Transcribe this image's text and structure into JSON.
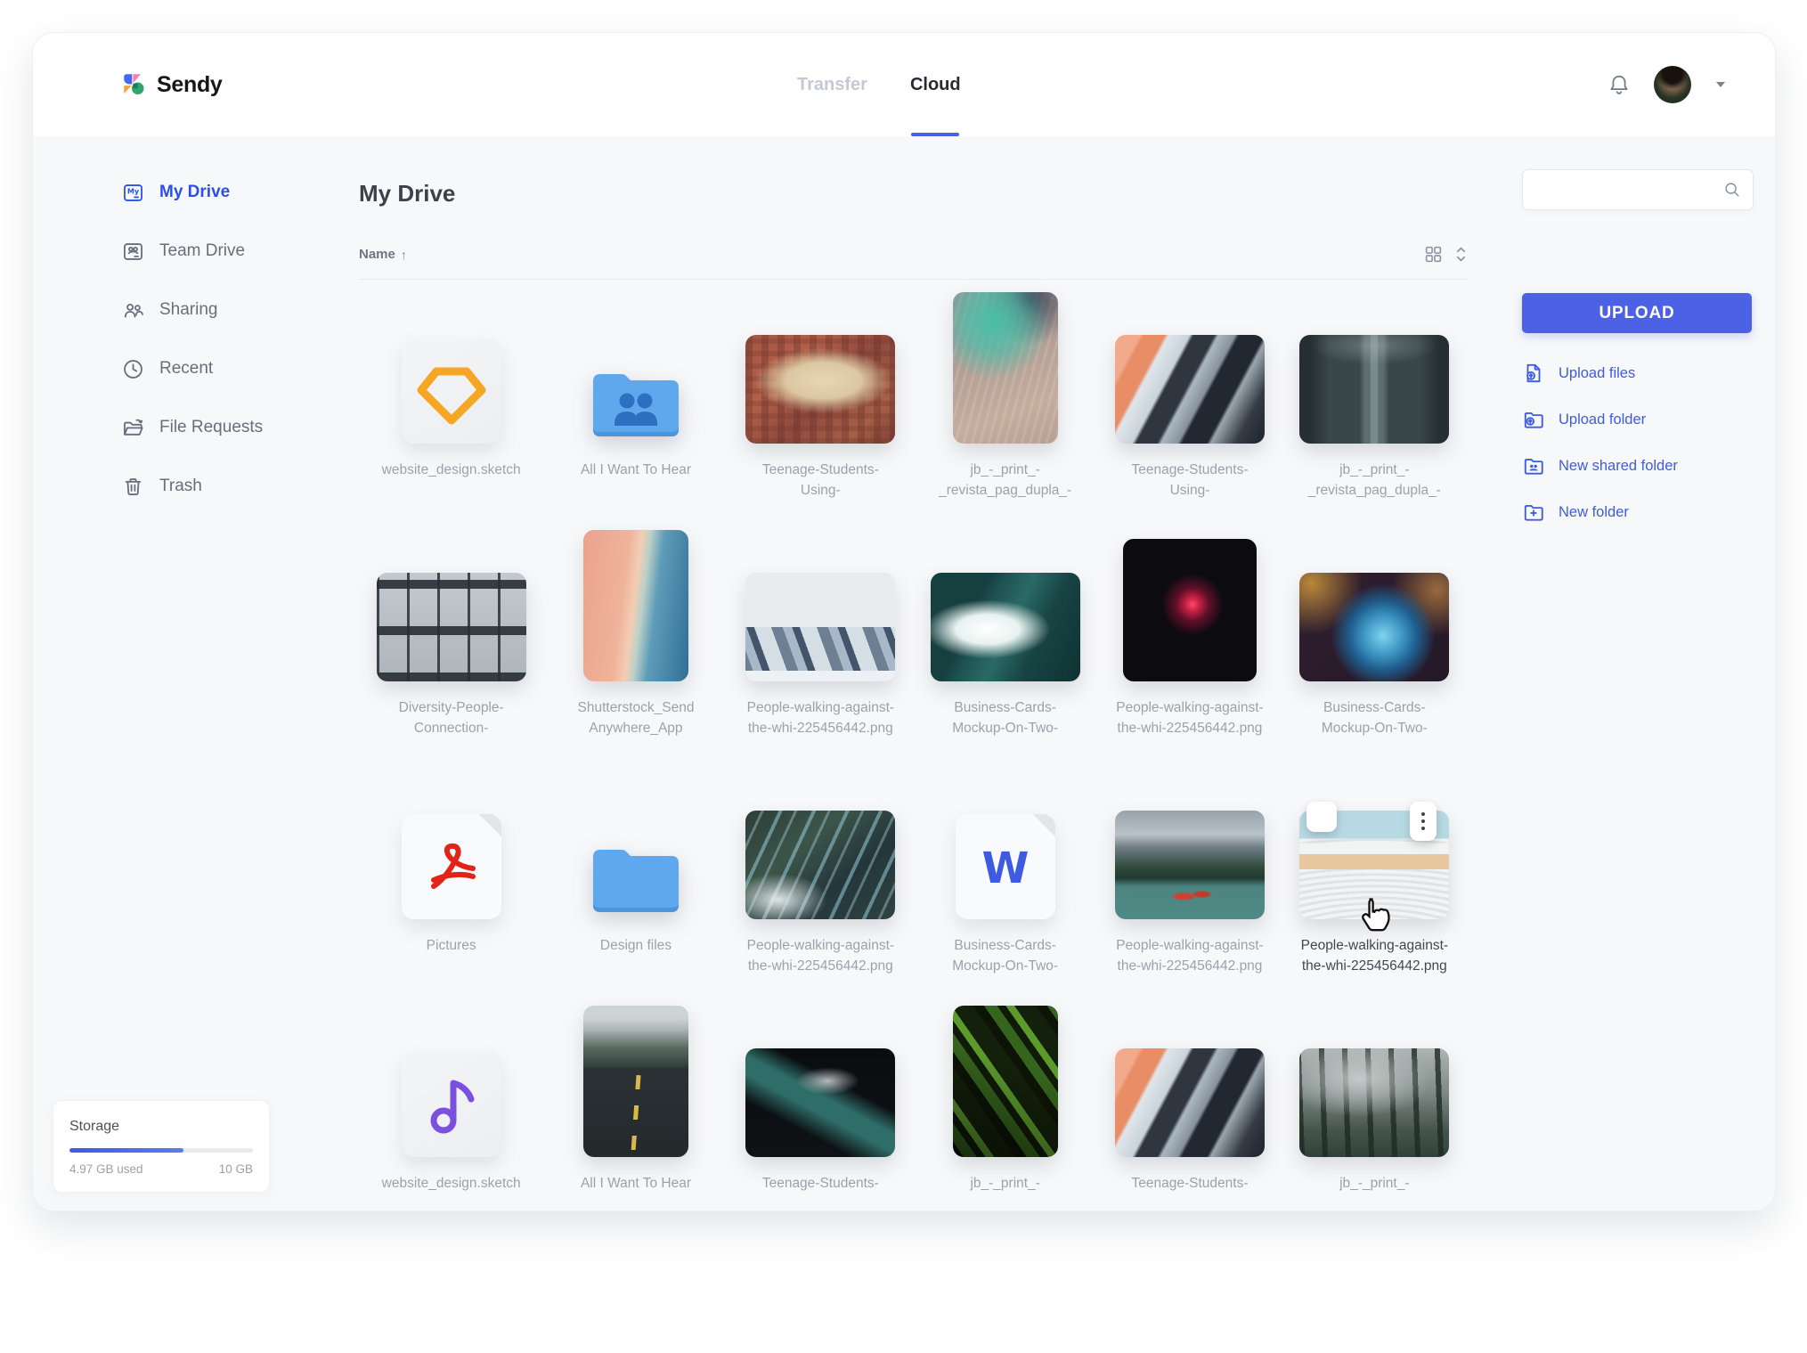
{
  "header": {
    "logo": "Sendy",
    "logo_icon": "sendy-logo-mark",
    "tabs": [
      {
        "label": "Transfer",
        "active": false
      },
      {
        "label": "Cloud",
        "active": true
      }
    ],
    "notification_icon": "bell-icon",
    "avatar_icon": "user-avatar-photo",
    "caret_icon": "chevron-down-icon"
  },
  "sidebar": {
    "items": [
      {
        "label": "My Drive",
        "icon": "my-drive-icon",
        "active": true
      },
      {
        "label": "Team Drive",
        "icon": "team-drive-icon",
        "active": false
      },
      {
        "label": "Sharing",
        "icon": "sharing-icon",
        "active": false
      },
      {
        "label": "Recent",
        "icon": "recent-icon",
        "active": false
      },
      {
        "label": "File Requests",
        "icon": "file-requests-icon",
        "active": false
      },
      {
        "label": "Trash",
        "icon": "trash-icon",
        "active": false
      }
    ]
  },
  "storage": {
    "title": "Storage",
    "used": "4.97 GB used",
    "total": "10 GB",
    "fraction": 0.62,
    "bar_color": "#4C61E6"
  },
  "main": {
    "title": "My Drive",
    "sort": {
      "label": "Name",
      "arrow": "↑",
      "direction": "ascending"
    },
    "view_icons": [
      "grid-view-icon",
      "sort-order-icon"
    ]
  },
  "search": {
    "value": "",
    "placeholder": "",
    "icon": "search-icon"
  },
  "actions": {
    "upload_button": "UPLOAD",
    "accent_color": "#4C61E6",
    "links": [
      {
        "label": "Upload files",
        "icon": "file-upload-icon"
      },
      {
        "label": "Upload folder",
        "icon": "folder-upload-icon"
      },
      {
        "label": "New shared folder",
        "icon": "shared-folder-add-icon"
      },
      {
        "label": "New folder",
        "icon": "new-folder-icon"
      }
    ]
  },
  "files": [
    {
      "name": "website_design.sketch",
      "thumb": "sketch-file-icon",
      "kind": "file"
    },
    {
      "name": "All I Want To Hear",
      "thumb": "shared-folder-icon",
      "kind": "folder"
    },
    {
      "name": "Teenage-Students-\nUsing-",
      "thumb": "city-aerial-image",
      "kind": "image"
    },
    {
      "name": "jb_-_print_-\n_revista_pag_dupla_-",
      "thumb": "river-delta-image",
      "kind": "image"
    },
    {
      "name": "Teenage-Students-\nUsing-",
      "thumb": "mountain-art-image",
      "kind": "image"
    },
    {
      "name": "jb_-_print_-\n_revista_pag_dupla_-",
      "thumb": "forest-road-aerial-image",
      "kind": "image"
    },
    {
      "name": "Diversity-People-\nConnection-",
      "thumb": "building-facade-image",
      "kind": "image"
    },
    {
      "name": "Shutterstock_Send\nAnywhere_App",
      "thumb": "beach-aerial-image",
      "kind": "image"
    },
    {
      "name": "People-walking-against-\nthe-whi-225456442.png",
      "thumb": "snow-mountains-image",
      "kind": "image"
    },
    {
      "name": "Business-Cards-\nMockup-On-Two-",
      "thumb": "ocean-wave-image",
      "kind": "image"
    },
    {
      "name": "People-walking-against-\nthe-whi-225456442.png",
      "thumb": "red-nebula-image",
      "kind": "image"
    },
    {
      "name": "Business-Cards-\nMockup-On-Two-",
      "thumb": "blue-nebula-image",
      "kind": "image"
    },
    {
      "name": "Pictures",
      "thumb": "pdf-file-icon",
      "kind": "file"
    },
    {
      "name": "Design files",
      "thumb": "folder-icon",
      "kind": "folder"
    },
    {
      "name": "People-walking-against-\nthe-whi-225456442.png",
      "thumb": "braided-rivers-image",
      "kind": "image"
    },
    {
      "name": "Business-Cards-\nMockup-On-Two-",
      "thumb": "word-file-icon",
      "kind": "file"
    },
    {
      "name": "People-walking-against-\nthe-whi-225456442.png",
      "thumb": "lake-canoes-image",
      "kind": "image"
    },
    {
      "name": "People-walking-against-\nthe-whi-225456442.png",
      "thumb": "amphitheater-image",
      "kind": "image",
      "selected": true
    },
    {
      "name": "website_design.sketch",
      "thumb": "music-file-icon",
      "kind": "file"
    },
    {
      "name": "All I Want To Hear",
      "thumb": "mountain-road-image",
      "kind": "image"
    },
    {
      "name": "Teenage-Students-",
      "thumb": "night-pier-image",
      "kind": "image"
    },
    {
      "name": "jb_-_print_-",
      "thumb": "green-feather-image",
      "kind": "image"
    },
    {
      "name": "Teenage-Students-",
      "thumb": "mountain-art-image",
      "kind": "image"
    },
    {
      "name": "jb_-_print_-",
      "thumb": "foggy-forest-image",
      "kind": "image"
    }
  ]
}
